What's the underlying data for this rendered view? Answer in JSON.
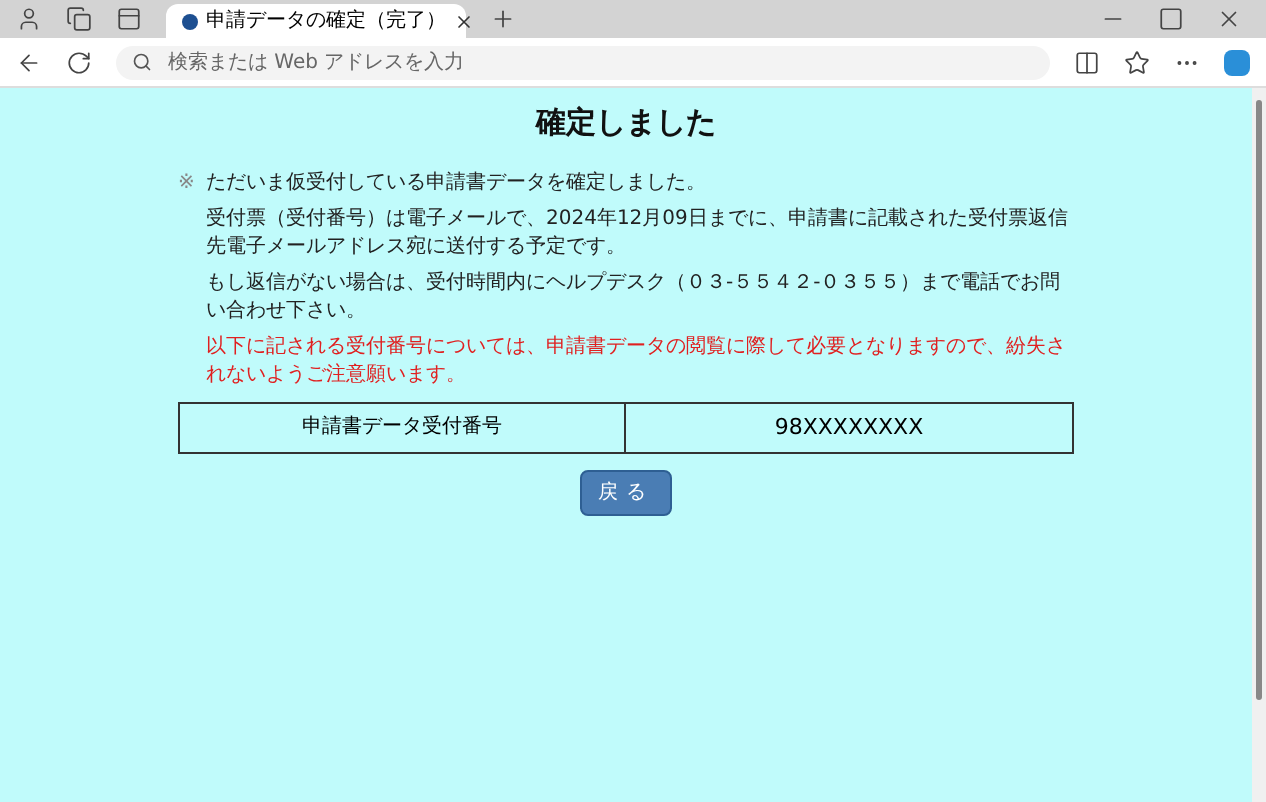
{
  "browser": {
    "tab_title": "申請データの確定（完了）",
    "address_placeholder": "検索または Web アドレスを入力"
  },
  "page": {
    "title": "確定しました",
    "notes": [
      {
        "kind": "bullet",
        "text": "ただいま仮受付している申請書データを確定しました。",
        "bullet": "※"
      },
      {
        "kind": "plain",
        "text": "受付票（受付番号）は電子メールで、2024年12月09日までに、申請書に記載された受付票返信先電子メールアドレス宛に送付する予定です。"
      },
      {
        "kind": "plain",
        "text": "もし返信がない場合は、受付時間内にヘルプデスク（０３-５５４２-０３５５）まで電話でお問い合わせ下さい。"
      },
      {
        "kind": "warning",
        "text": "以下に記される受付番号については、申請書データの閲覧に際して必要となりますので、紛失されないようご注意願います。"
      }
    ],
    "table": {
      "label": "申請書データ受付番号",
      "value": "98XXXXXXXX"
    },
    "back_button": "戻る"
  }
}
